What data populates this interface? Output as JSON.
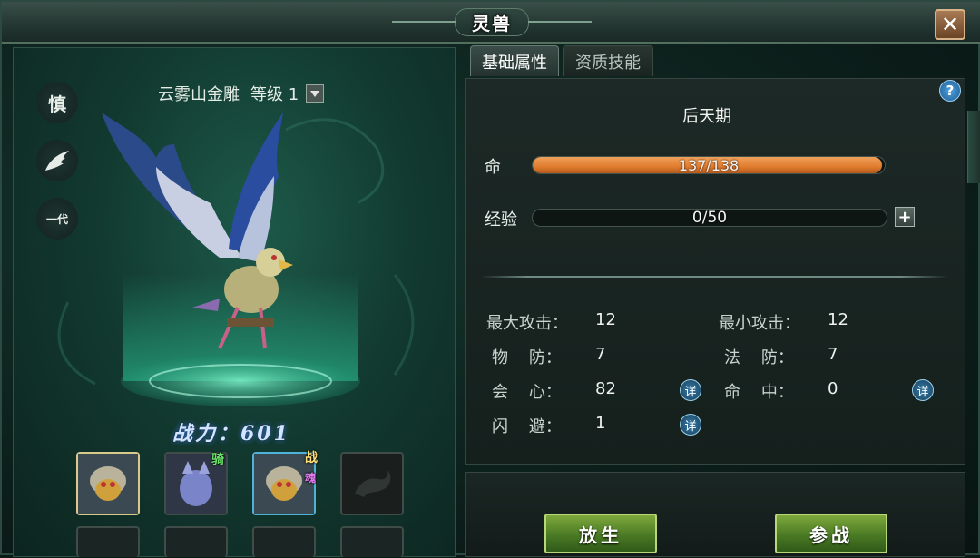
{
  "window": {
    "title": "灵兽",
    "close_icon": "close-icon"
  },
  "left": {
    "side_icons": [
      {
        "icon": "temperament-icon",
        "label": "慎"
      },
      {
        "icon": "wing-icon",
        "label": ""
      },
      {
        "icon": "generation-icon",
        "label": "一代"
      }
    ],
    "pet_name": "云雾山金雕",
    "level_label": "等级 1",
    "power_label": "战力：601",
    "slots": [
      {
        "state": "selected",
        "badge": ""
      },
      {
        "state": "normal",
        "badge": "骑"
      },
      {
        "state": "active",
        "badge": "战",
        "badge2": "魂"
      },
      {
        "state": "locked",
        "badge": ""
      }
    ]
  },
  "tabs": [
    {
      "label": "基础属性",
      "active": true
    },
    {
      "label": "资质技能",
      "active": false
    }
  ],
  "attributes": {
    "stage": "后天期",
    "hp": {
      "label": "命",
      "text": "137/138",
      "current": 137,
      "max": 138,
      "color": "#e07c2e"
    },
    "exp": {
      "label": "经验",
      "text": "0/50",
      "current": 0,
      "max": 50
    },
    "stats": [
      {
        "label": "最大攻击：",
        "value": "12"
      },
      {
        "label": "最小攻击：",
        "value": "12"
      },
      {
        "label": "物    防：",
        "value": "7"
      },
      {
        "label": "法    防：",
        "value": "7"
      },
      {
        "label": "会    心：",
        "value": "82"
      },
      {
        "label": "命    中：",
        "value": "0"
      },
      {
        "label": "闪    避：",
        "value": "1"
      }
    ],
    "detail_label": "详"
  },
  "actions": {
    "release": "放生",
    "battle": "参战"
  }
}
